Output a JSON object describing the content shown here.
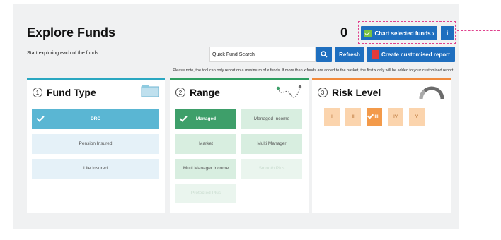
{
  "header": {
    "title": "Explore Funds",
    "selected_count": "0",
    "chart_button_label": "Chart selected funds ›",
    "info_button_label": "i"
  },
  "toolbar": {
    "subtitle": "Start exploring each of the funds",
    "quick_search_label": "Quick Fund Search",
    "search_icon": "search-icon",
    "refresh_label": "Refresh",
    "report_label": "Create customised report"
  },
  "note": "Please note, the tool can only report on a maximum of x funds. If more than x funds are added to the basket, the first x only will be added to your customised report.",
  "colors": {
    "primary_blue": "#1f6fbf",
    "fund_type_accent": "#2aa7c1",
    "range_accent": "#2f9e61",
    "risk_accent": "#f08a3c",
    "annotation_pink": "#e0428e"
  },
  "cards": {
    "fund_type": {
      "number": "1",
      "title": "Fund Type",
      "icon": "folder-icon",
      "options": [
        {
          "label": "DRC",
          "selected": true
        },
        {
          "label": "Pension Insured",
          "selected": false
        },
        {
          "label": "Life Insured",
          "selected": false
        }
      ]
    },
    "range": {
      "number": "2",
      "title": "Range",
      "icon": "route-icon",
      "options": [
        {
          "label": "Managed",
          "selected": true
        },
        {
          "label": "Managed Income",
          "selected": false
        },
        {
          "label": "Market",
          "selected": false
        },
        {
          "label": "Multi Manager",
          "selected": false
        },
        {
          "label": "Multi Manager Income",
          "selected": false
        },
        {
          "label": "Smooth Plus",
          "selected": false,
          "faded": true
        },
        {
          "label": "Protected Plus",
          "selected": false,
          "faded": true
        }
      ]
    },
    "risk_level": {
      "number": "3",
      "title": "Risk Level",
      "icon": "gauge-icon",
      "options": [
        {
          "label": "I",
          "selected": false
        },
        {
          "label": "II",
          "selected": false
        },
        {
          "label": "III",
          "selected": true
        },
        {
          "label": "IV",
          "selected": false
        },
        {
          "label": "V",
          "selected": false
        }
      ]
    }
  }
}
